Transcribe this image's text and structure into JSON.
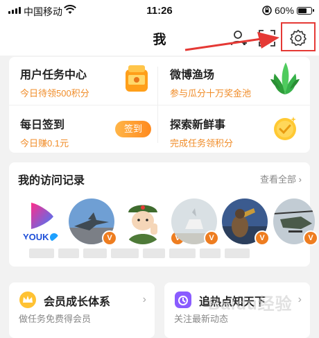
{
  "status_bar": {
    "carrier": "中国移动",
    "time": "11:26",
    "battery": "60%"
  },
  "header": {
    "title": "我"
  },
  "tasks": [
    {
      "title": "用户任务中心",
      "subtitle": "今日待领500积分",
      "icon": "coin-jar-icon"
    },
    {
      "title": "微博渔场",
      "subtitle": "参与瓜分十万奖金池",
      "icon": "plant-icon"
    },
    {
      "title": "每日签到",
      "subtitle": "今日赚0.1元",
      "button": "签到"
    },
    {
      "title": "探索新鲜事",
      "subtitle": "完成任务领积分",
      "icon": "check-coin-icon"
    }
  ],
  "visits": {
    "title": "我的访问记录",
    "view_all": "查看全部",
    "items": [
      {
        "name": "youku",
        "logo_text": "YOUK"
      },
      {
        "name": "fighter-jet"
      },
      {
        "name": "soldier-cartoon"
      },
      {
        "name": "horse-rider"
      },
      {
        "name": "bugle-soldier"
      },
      {
        "name": "helicopter"
      }
    ]
  },
  "bottom_cards": [
    {
      "title": "会员成长体系",
      "subtitle": "做任务免费得会员"
    },
    {
      "title": "追热点知天下",
      "subtitle": "关注最新动态"
    }
  ],
  "watermark": "Baidu经验",
  "colors": {
    "orange": "#f08c28",
    "red": "#e53935",
    "verified": "#ee7d20"
  }
}
